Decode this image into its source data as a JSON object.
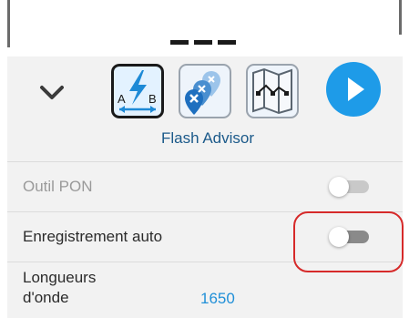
{
  "toolbar": {
    "flash_icon_letters": {
      "left": "A",
      "right": "B"
    },
    "mode_label": "Flash Advisor",
    "accent_color": "#1e9be8"
  },
  "settings": {
    "rows": [
      {
        "label": "Outil PON",
        "control": "toggle",
        "state": "off",
        "enabled": false
      },
      {
        "label": "Enregistrement auto",
        "control": "toggle",
        "state": "off",
        "enabled": true
      },
      {
        "label_line1": "Longueurs",
        "label_line2": "d'onde",
        "value": "1650"
      }
    ]
  },
  "annotation_color": "#d62a2a"
}
